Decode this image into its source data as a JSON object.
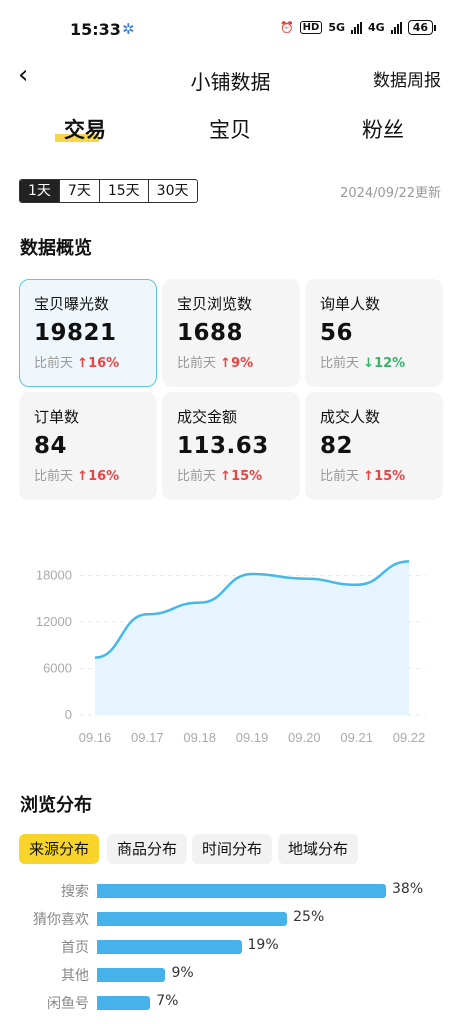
{
  "status": {
    "time": "15:33",
    "hd": "HD",
    "net1": "5G",
    "net2": "4G",
    "battery": "46"
  },
  "nav": {
    "back": "‹",
    "title": "小铺数据",
    "weekly": "数据周报"
  },
  "tabs": [
    "交易",
    "宝贝",
    "粉丝"
  ],
  "periods": [
    "1天",
    "7天",
    "15天",
    "30天"
  ],
  "updated": "2024/09/22更新",
  "overview_title": "数据概览",
  "cards": [
    {
      "label": "宝贝曝光数",
      "value": "19821",
      "cmp": "比前天",
      "dir": "up",
      "arrow": "↑",
      "change": "16%"
    },
    {
      "label": "宝贝浏览数",
      "value": "1688",
      "cmp": "比前天",
      "dir": "up",
      "arrow": "↑",
      "change": "9%"
    },
    {
      "label": "询单人数",
      "value": "56",
      "cmp": "比前天",
      "dir": "down",
      "arrow": "↓",
      "change": "12%"
    },
    {
      "label": "订单数",
      "value": "84",
      "cmp": "比前天",
      "dir": "up",
      "arrow": "↑",
      "change": "16%"
    },
    {
      "label": "成交金额",
      "value": "113.63",
      "cmp": "比前天",
      "dir": "up",
      "arrow": "↑",
      "change": "15%"
    },
    {
      "label": "成交人数",
      "value": "82",
      "cmp": "比前天",
      "dir": "up",
      "arrow": "↑",
      "change": "15%"
    }
  ],
  "chart_data": {
    "type": "area",
    "x": [
      "09.16",
      "09.17",
      "09.18",
      "09.19",
      "09.20",
      "09.21",
      "09.22"
    ],
    "series": [
      {
        "values": [
          7400,
          13000,
          14500,
          18200,
          17600,
          16800,
          19821
        ]
      }
    ],
    "yticks": [
      "0",
      "6000",
      "12000",
      "18000"
    ],
    "ylim": [
      0,
      20000
    ],
    "grid": true,
    "colors": {
      "line": "#47b8e8",
      "fill": "#e6f5fd",
      "grid": "#e8e8e8",
      "tick": "#aaaaaa"
    }
  },
  "dist_title": "浏览分布",
  "dist_tabs": [
    "来源分布",
    "商品分布",
    "时间分布",
    "地域分布"
  ],
  "dist_bars": [
    {
      "label": "搜索",
      "value": 38,
      "pct": "38%"
    },
    {
      "label": "猜你喜欢",
      "value": 25,
      "pct": "25%"
    },
    {
      "label": "首页",
      "value": 19,
      "pct": "19%"
    },
    {
      "label": "其他",
      "value": 9,
      "pct": "9%"
    },
    {
      "label": "闲鱼号",
      "value": 7,
      "pct": "7%"
    }
  ]
}
